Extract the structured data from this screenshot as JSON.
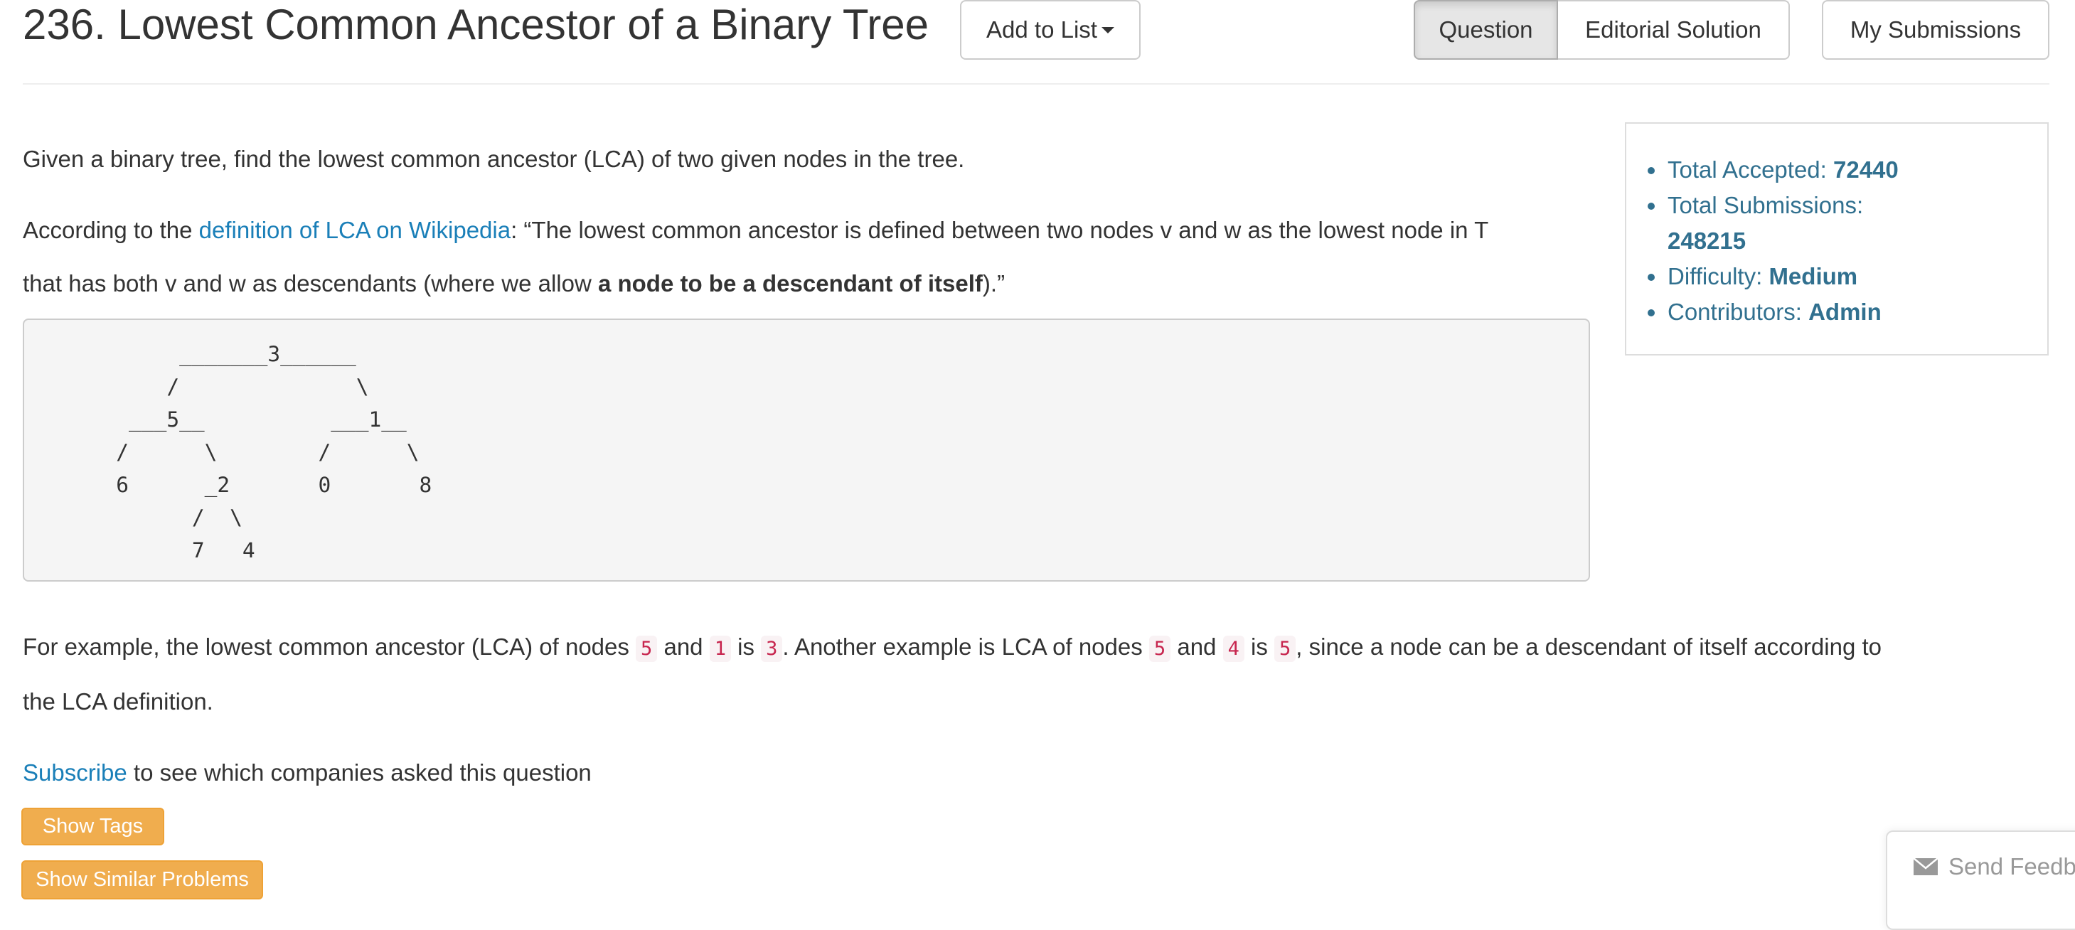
{
  "header": {
    "title": "236. Lowest Common Ancestor of a Binary Tree",
    "add_to_list_label": "Add to List",
    "tabs": [
      {
        "label": "Question",
        "active": true
      },
      {
        "label": "Editorial Solution",
        "active": false
      }
    ],
    "my_submissions_label": "My Submissions"
  },
  "description": {
    "intro": "Given a binary tree, find the lowest common ancestor (LCA) of two given nodes in the tree.",
    "def_prefix": "According to the ",
    "def_link": "definition of LCA on Wikipedia",
    "def_quote_line1": ": “The lowest common ancestor is defined between two nodes v and w as the lowest node in T",
    "def_quote_line2_start": "that has both v and w as descendants (where we allow ",
    "def_quote_bold": "a node to be a descendant of itself",
    "def_quote_end": ").”",
    "tree_diagram": "        _______3______\n       /              \\\n    ___5__          ___1__\n   /      \\        /      \\\n   6      _2       0       8\n         /  \\\n         7   4",
    "example": {
      "t1": "For example, the lowest common ancestor (LCA) of nodes ",
      "c1": "5",
      "t2": " and ",
      "c2": "1",
      "t3": " is ",
      "c3": "3",
      "t4": ". Another example is LCA of nodes ",
      "c4": "5",
      "t5": " and ",
      "c5": "4",
      "t6": " is ",
      "c6": "5",
      "t7": ", since a node can be a descendant of itself according to",
      "line2": "the LCA definition."
    },
    "subscribe_link": "Subscribe",
    "subscribe_rest": " to see which companies asked this question"
  },
  "buttons": {
    "show_tags": "Show Tags",
    "show_similar": "Show Similar Problems"
  },
  "stats": {
    "total_accepted_label": "Total Accepted: ",
    "total_accepted": "72440",
    "total_submissions_label": "Total Submissions: ",
    "total_submissions": "248215",
    "difficulty_label": "Difficulty: ",
    "difficulty": "Medium",
    "contributors_label": "Contributors: ",
    "contributors": "Admin"
  },
  "feedback": {
    "icon": "envelope-icon",
    "label": "Send Feedb"
  },
  "colors": {
    "link": "#1a7fb8",
    "stats_text": "#31708f",
    "warning_button": "#f0ad4e",
    "code_text": "#c7254e",
    "code_bg": "#f9f2f4"
  }
}
